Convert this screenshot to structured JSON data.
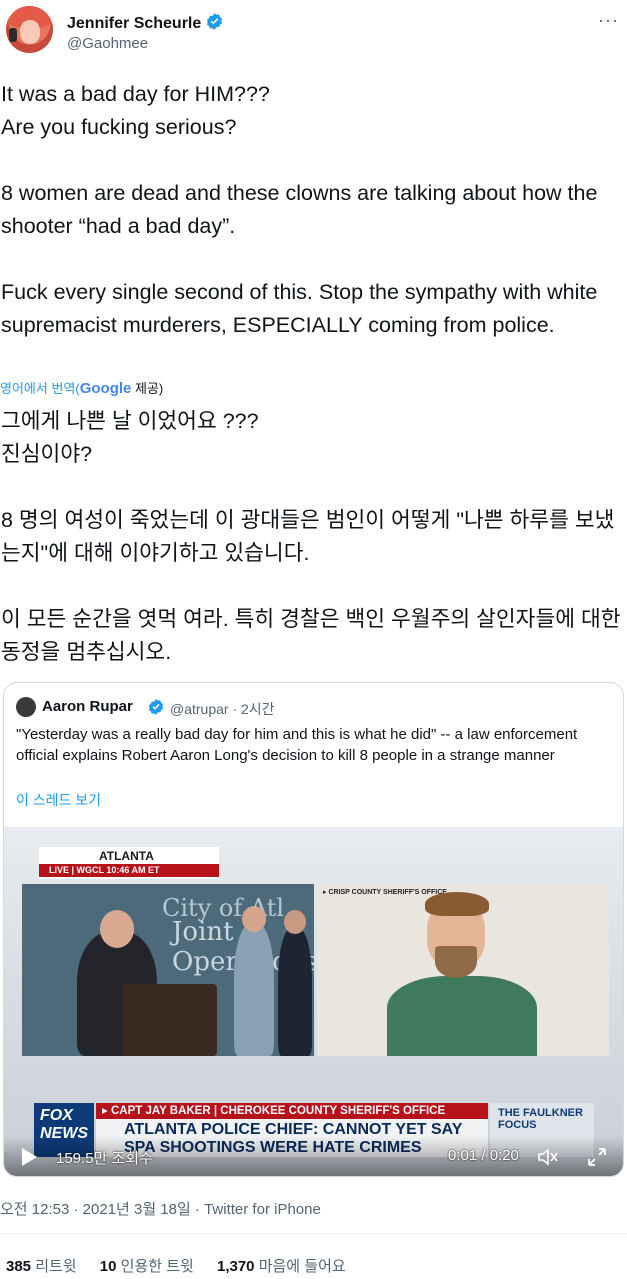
{
  "author": {
    "name": "Jennifer Scheurle",
    "handle": "@Gaohmee"
  },
  "tweet": {
    "text": "It was a bad day for HIM???\nAre you fucking serious?\n\n8 women are dead and these clowns are talking about how the shooter “had a bad day”.\n\nFuck every single second of this. Stop the sympathy with white supremacist murderers, ESPECIALLY coming from police.",
    "translate_prefix": "영어에서 번역(",
    "translate_google": "Google",
    "translate_suffix": " 제공)",
    "translated_text": "그에게 나쁜 날 이었어요 ???\n 진심이야?\n\n 8 명의 여성이 죽었는데 이 광대들은 범인이 어떻게 \"나쁜 하루를 보냈는지\"에 대해 이야기하고 있습니다.\n\n 이 모든 순간을 엿먹 여라. 특히 경찰은 백인 우월주의 살인자들에 대한 동정을 멈추십시오."
  },
  "quote": {
    "name": "Aaron Rupar",
    "handle_time": "@atrupar · 2시간",
    "text": "\"Yesterday was a really bad day for him and this is what he did\" -- a law enforcement official explains Robert Aaron Long's decision to kill 8 people in a strange manner",
    "thread_link": "이 스레드 보기",
    "video": {
      "location": "ATLANTA",
      "live_bar": "LIVE  |  WGCL    10:46 AM ET",
      "wall_text_1": "City of Atl",
      "wall_text_2": "Joint Operations",
      "mugshot_tag": "▸ CRISP COUNTY SHERIFF'S OFFICE",
      "network": "FOX NEWS",
      "strap": "▸ CAPT JAY BAKER | CHEROKEE COUNTY SHERIFF'S OFFICE",
      "headline": "ATLANTA POLICE CHIEF: CANNOT YET SAY\nSPA SHOOTINGS WERE HATE CRIMES",
      "side_show": "THE FAULKNER FOCUS",
      "views": "159.5만 조회수",
      "time": "0:01 / 0:20"
    }
  },
  "meta": {
    "timestamp": "오전 12:53 · 2021년 3월 18일 · Twitter for iPhone"
  },
  "stats": {
    "retweets_count": "385",
    "retweets_label": "리트윗",
    "quotes_count": "10",
    "quotes_label": "인용한 트윗",
    "likes_count": "1,370",
    "likes_label": "마음에 들어요"
  },
  "colors": {
    "accent": "#1d9bf0",
    "text": "#0f1419",
    "secondary": "#536471",
    "fox_red": "#b5121b"
  }
}
